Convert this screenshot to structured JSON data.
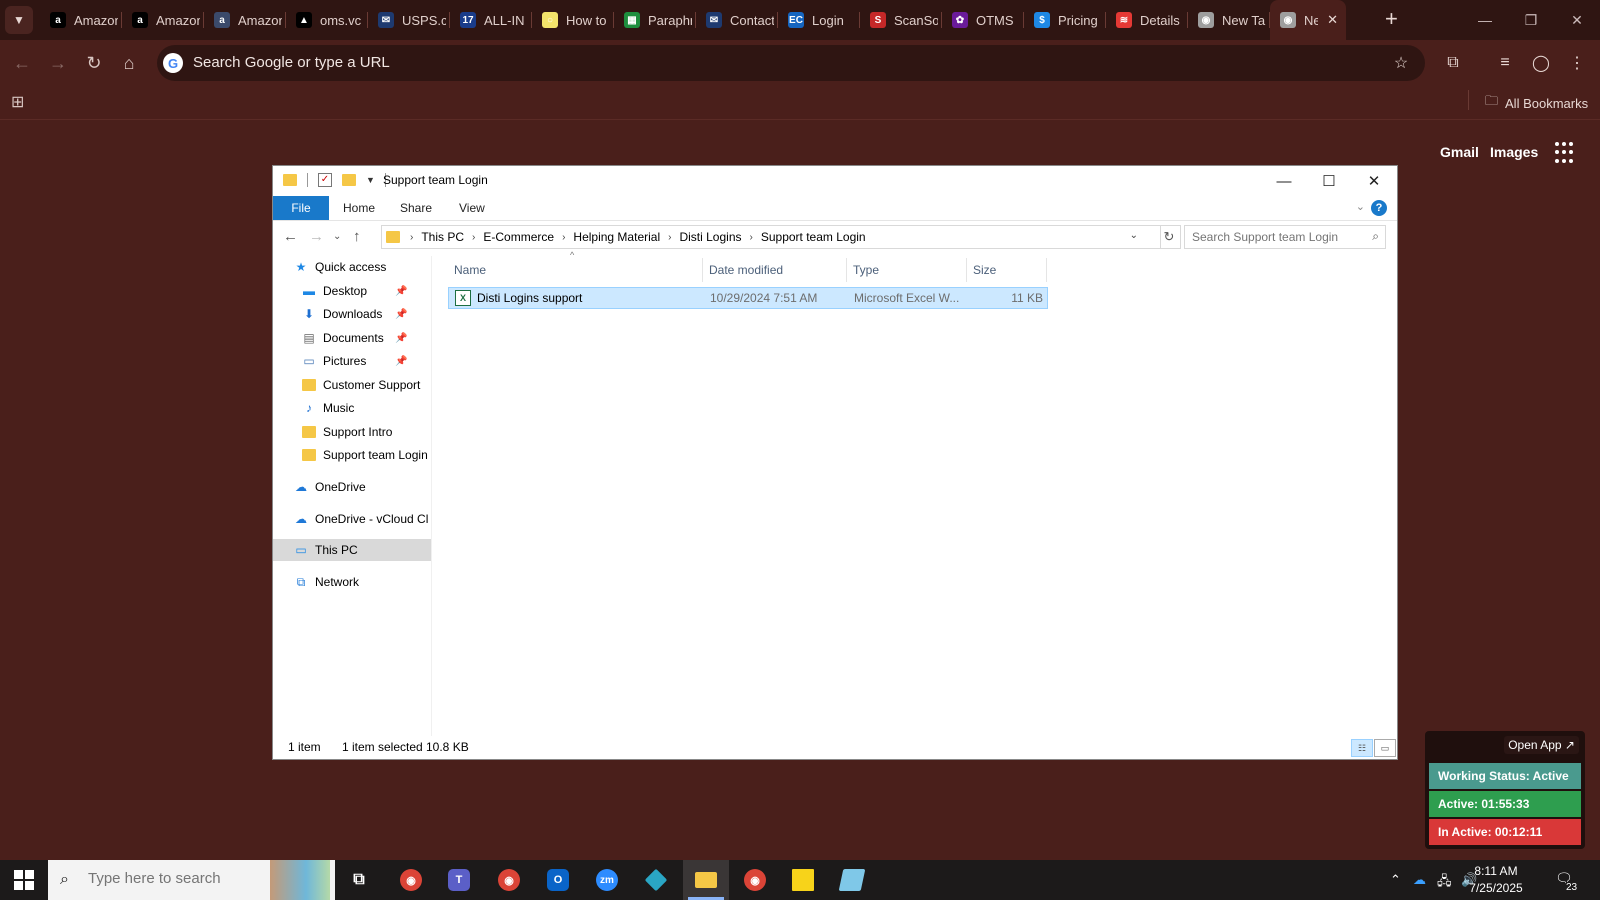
{
  "browser": {
    "tabs": [
      {
        "title": "Amazon",
        "favicon": "amazon-icon",
        "color": "#000000",
        "glyph": "a"
      },
      {
        "title": "Amazon",
        "favicon": "amazon-icon",
        "color": "#000000",
        "glyph": "a"
      },
      {
        "title": "Amazon",
        "favicon": "amazon-icon",
        "color": "#3b4a6b",
        "glyph": "a"
      },
      {
        "title": "oms.vc",
        "favicon": "oms-icon",
        "color": "#000000",
        "glyph": "▲"
      },
      {
        "title": "USPS.com",
        "favicon": "usps-icon",
        "color": "#1e3a70",
        "glyph": "✉"
      },
      {
        "title": "ALL-IN",
        "favicon": "allin-icon",
        "color": "#1a3c8a",
        "glyph": "17"
      },
      {
        "title": "How to",
        "favicon": "howto-icon",
        "color": "#f2e36b",
        "glyph": "○"
      },
      {
        "title": "Paraphrase",
        "favicon": "sheets-icon",
        "color": "#1e8e3e",
        "glyph": "▦"
      },
      {
        "title": "Contact",
        "favicon": "usps-icon",
        "color": "#1e3a70",
        "glyph": "✉"
      },
      {
        "title": "Login",
        "favicon": "ec-icon",
        "color": "#1565c0",
        "glyph": "EC"
      },
      {
        "title": "ScanSource",
        "favicon": "scansource-icon",
        "color": "#c62828",
        "glyph": "S"
      },
      {
        "title": "OTMS",
        "favicon": "otms-icon",
        "color": "#6a1b9a",
        "glyph": "✿"
      },
      {
        "title": "Pricing",
        "favicon": "pricing-icon",
        "color": "#1e88e5",
        "glyph": "$"
      },
      {
        "title": "Details",
        "favicon": "details-icon",
        "color": "#e53935",
        "glyph": "≋"
      },
      {
        "title": "New Tab",
        "favicon": "chrome-icon",
        "color": "#9e9e9e",
        "glyph": "◉"
      },
      {
        "title": "New Tab",
        "favicon": "chrome-icon",
        "color": "#9e9e9e",
        "glyph": "◉",
        "active": true
      }
    ],
    "omnibox_placeholder": "Search Google or type a URL",
    "all_bookmarks": "All Bookmarks",
    "ntp_links": {
      "gmail": "Gmail",
      "images": "Images"
    }
  },
  "explorer": {
    "title": "Support team Login",
    "ribbon_tabs": [
      "File",
      "Home",
      "Share",
      "View"
    ],
    "help": "?",
    "breadcrumb": [
      "This PC",
      "E-Commerce",
      "Helping Material",
      "Disti Logins",
      "Support team Login"
    ],
    "search_placeholder": "Search Support team Login",
    "nav_pane": [
      {
        "label": "Quick access",
        "icon": "star-icon",
        "indent": 0,
        "pinned": false
      },
      {
        "label": "Desktop",
        "icon": "desktop-icon",
        "indent": 1,
        "pinned": true
      },
      {
        "label": "Downloads",
        "icon": "download-icon",
        "indent": 1,
        "pinned": true
      },
      {
        "label": "Documents",
        "icon": "document-icon",
        "indent": 1,
        "pinned": true
      },
      {
        "label": "Pictures",
        "icon": "pictures-icon",
        "indent": 1,
        "pinned": true
      },
      {
        "label": "Customer Support",
        "icon": "folder-icon",
        "indent": 1,
        "pinned": false
      },
      {
        "label": "Music",
        "icon": "music-icon",
        "indent": 1,
        "pinned": false
      },
      {
        "label": "Support Intro",
        "icon": "folder-icon",
        "indent": 1,
        "pinned": false
      },
      {
        "label": "Support team Login",
        "icon": "folder-icon",
        "indent": 1,
        "pinned": false
      },
      {
        "label": "OneDrive",
        "icon": "onedrive-icon",
        "indent": 0,
        "pinned": false
      },
      {
        "label": "OneDrive - vCloud Cl",
        "icon": "onedrive-icon",
        "indent": 0,
        "pinned": false
      },
      {
        "label": "This PC",
        "icon": "pc-icon",
        "indent": 0,
        "pinned": false,
        "selected": true
      },
      {
        "label": "Network",
        "icon": "network-icon",
        "indent": 0,
        "pinned": false
      }
    ],
    "columns": [
      "Name",
      "Date modified",
      "Type",
      "Size"
    ],
    "files": [
      {
        "name": "Disti Logins support",
        "date": "10/29/2024 7:51 AM",
        "type": "Microsoft Excel W...",
        "size": "11 KB"
      }
    ],
    "status": {
      "count": "1 item",
      "selected": "1 item selected",
      "size": "10.8 KB"
    }
  },
  "tracker": {
    "open_app": "Open App ↗",
    "status": "Working Status: Active",
    "active": "Active: 01:55:33",
    "inactive": "In Active: 00:12:11",
    "colors": {
      "status": "#4a9a8e",
      "active": "#2e9e4f",
      "inactive": "#d93838"
    }
  },
  "taskbar": {
    "search_placeholder": "Type here to search",
    "apps": [
      "task-view-icon",
      "chrome-icon",
      "teams-icon",
      "chrome-profile-icon",
      "outlook-icon",
      "zoom-icon",
      "app-diamond-icon",
      "file-explorer-icon",
      "chrome-alt-icon",
      "sticky-notes-icon",
      "notepad-icon"
    ],
    "time": "8:11 AM",
    "date": "7/25/2025",
    "notification_count": "23"
  }
}
